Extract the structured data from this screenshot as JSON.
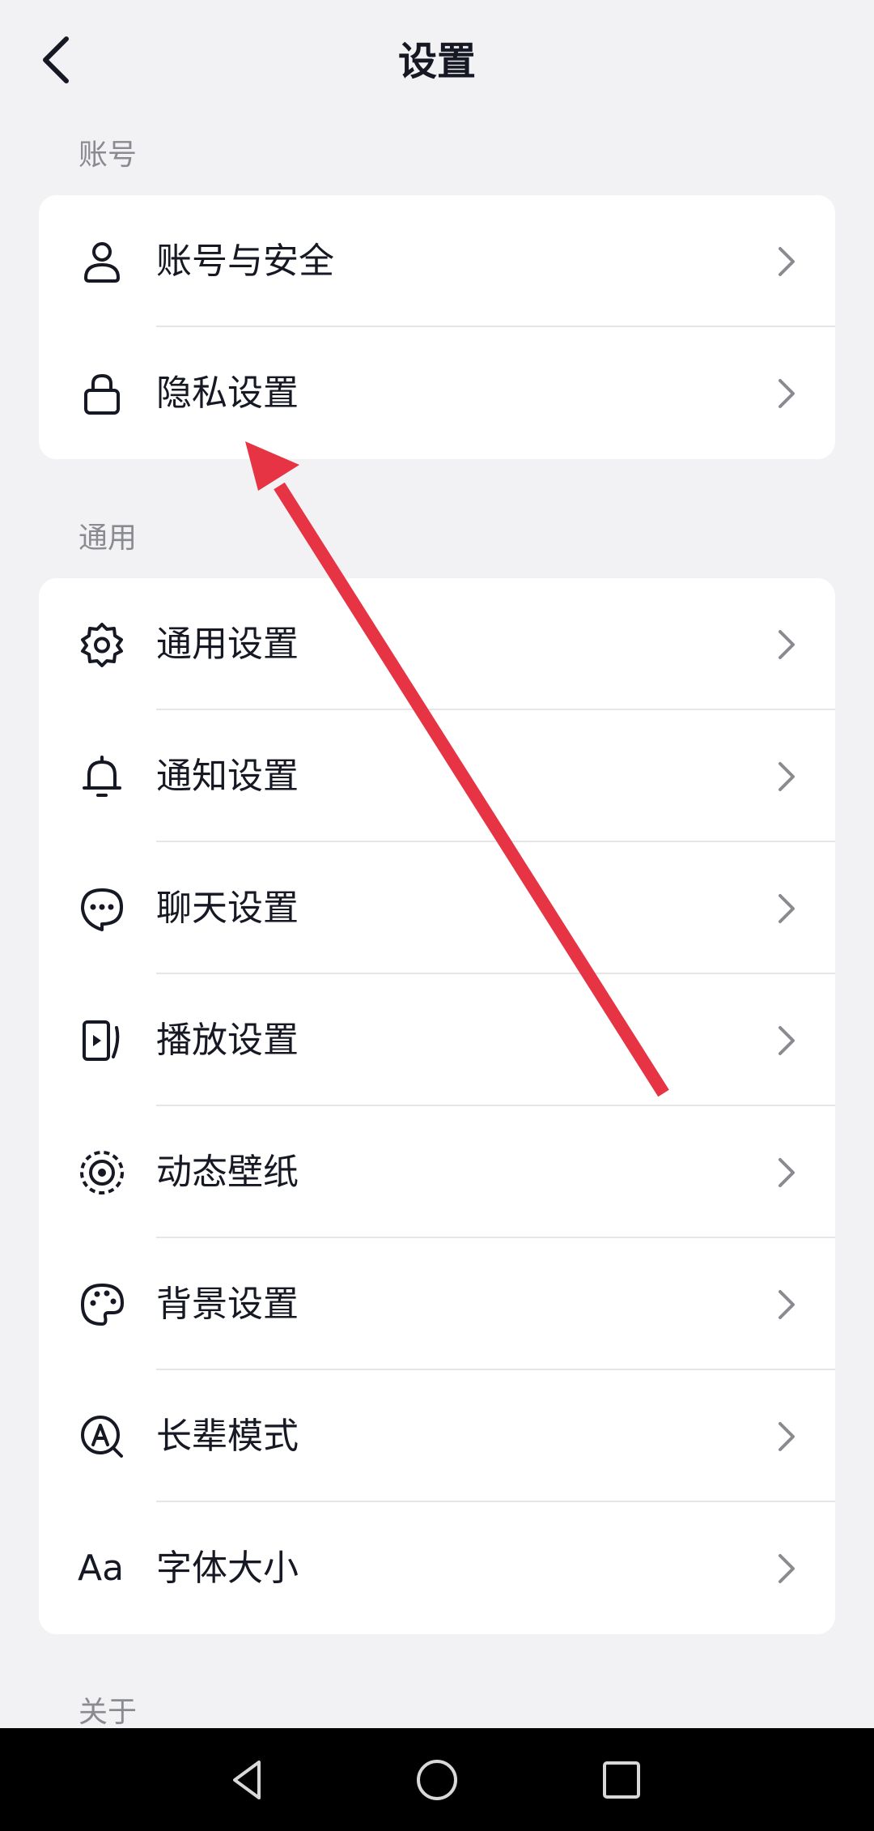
{
  "header": {
    "title": "设置"
  },
  "sections": [
    {
      "label": "账号",
      "items": [
        {
          "label": "账号与安全",
          "icon": "user-icon"
        },
        {
          "label": "隐私设置",
          "icon": "lock-icon"
        }
      ]
    },
    {
      "label": "通用",
      "items": [
        {
          "label": "通用设置",
          "icon": "gear-icon"
        },
        {
          "label": "通知设置",
          "icon": "bell-icon"
        },
        {
          "label": "聊天设置",
          "icon": "chat-bubble-icon"
        },
        {
          "label": "播放设置",
          "icon": "play-screen-icon"
        },
        {
          "label": "动态壁纸",
          "icon": "wallpaper-target-icon"
        },
        {
          "label": "背景设置",
          "icon": "palette-icon"
        },
        {
          "label": "长辈模式",
          "icon": "elder-mode-a-icon"
        },
        {
          "label": "字体大小",
          "icon": "font-size-icon",
          "icon_text": "Aa"
        }
      ]
    },
    {
      "label": "关于"
    }
  ],
  "colors": {
    "annotation_arrow": "#e63445",
    "background": "#f2f2f4",
    "card": "#ffffff"
  }
}
